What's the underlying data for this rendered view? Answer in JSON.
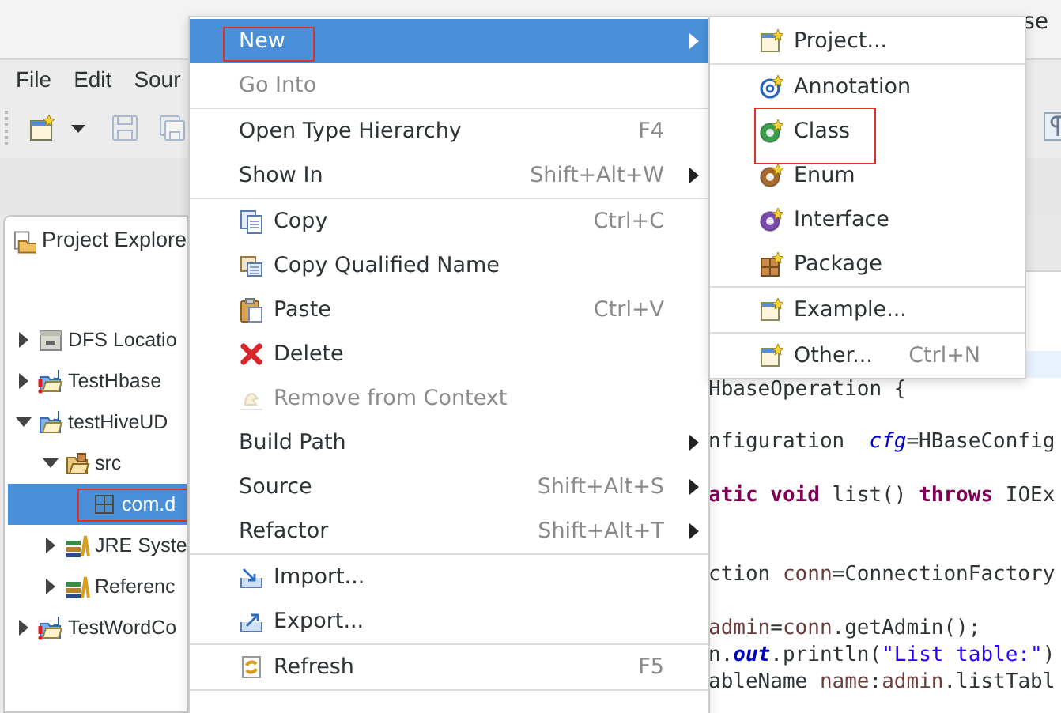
{
  "window": {
    "title": "se"
  },
  "menu_bar": [
    {
      "label": "File"
    },
    {
      "label": "Edit"
    },
    {
      "label": "Sour"
    }
  ],
  "toolbar": [
    {
      "kind": "new",
      "disabled": false
    },
    {
      "kind": "dropdown",
      "disabled": false
    },
    {
      "kind": "save",
      "disabled": true
    },
    {
      "kind": "save-all",
      "disabled": true
    },
    {
      "kind": "whitespace",
      "disabled": false
    }
  ],
  "project_explorer": {
    "title": "Project Explore",
    "items": [
      {
        "label": "DFS Locatio",
        "kind": "server",
        "expanded": false,
        "selected": false,
        "error": false,
        "framed": false
      },
      {
        "label": "TestHbase",
        "kind": "project",
        "expanded": false,
        "selected": false,
        "error": true,
        "framed": false
      },
      {
        "label": "testHiveUD",
        "kind": "project",
        "expanded": true,
        "selected": false,
        "error": false,
        "framed": false,
        "children": [
          {
            "label": "src",
            "kind": "source-folder",
            "expanded": true,
            "selected": false,
            "error": false,
            "framed": false,
            "children": [
              {
                "label": "com.d",
                "kind": "package",
                "selected": true,
                "error": false,
                "framed": true
              }
            ]
          },
          {
            "label": "JRE Syste",
            "kind": "library",
            "expanded": false,
            "selected": false,
            "error": false,
            "framed": false
          },
          {
            "label": "Referenc",
            "kind": "library",
            "expanded": false,
            "selected": false,
            "error": false,
            "framed": false
          }
        ]
      },
      {
        "label": "TestWordCo",
        "kind": "project",
        "expanded": false,
        "selected": false,
        "error": true,
        "framed": false
      }
    ]
  },
  "editor": {
    "lines": [
      {
        "kind": "blank",
        "current": true
      },
      {
        "kind": "code",
        "current": false,
        "tokens": [
          {
            "text": "HbaseOperation {",
            "kind": "plain"
          }
        ]
      },
      {
        "kind": "blank",
        "current": false
      },
      {
        "kind": "code",
        "current": false,
        "tokens": [
          {
            "text": "nfiguration  ",
            "kind": "plain"
          },
          {
            "text": "cfg",
            "kind": "field"
          },
          {
            "text": "=HBaseConfig",
            "kind": "plain"
          }
        ]
      },
      {
        "kind": "blank",
        "current": false
      },
      {
        "kind": "code",
        "current": false,
        "tokens": [
          {
            "text": "atic void",
            "kind": "keyword"
          },
          {
            "text": " list() ",
            "kind": "plain"
          },
          {
            "text": "throws",
            "kind": "keyword"
          },
          {
            "text": " IOEx",
            "kind": "plain"
          }
        ]
      },
      {
        "kind": "blank",
        "current": false
      },
      {
        "kind": "blank",
        "current": false
      },
      {
        "kind": "code",
        "current": false,
        "tokens": [
          {
            "text": "ction ",
            "kind": "plain"
          },
          {
            "text": "conn",
            "kind": "variable"
          },
          {
            "text": "=ConnectionFactory",
            "kind": "plain"
          }
        ]
      },
      {
        "kind": "blank",
        "current": false
      },
      {
        "kind": "code",
        "current": false,
        "tokens": [
          {
            "text": "admin",
            "kind": "variable"
          },
          {
            "text": "=",
            "kind": "plain"
          },
          {
            "text": "conn",
            "kind": "variable"
          },
          {
            "text": ".getAdmin();",
            "kind": "plain"
          }
        ]
      },
      {
        "kind": "code",
        "current": false,
        "tokens": [
          {
            "text": "n.",
            "kind": "plain"
          },
          {
            "text": "out",
            "kind": "static"
          },
          {
            "text": ".println(",
            "kind": "plain"
          },
          {
            "text": "\"List table:\"",
            "kind": "string"
          },
          {
            "text": ")",
            "kind": "plain"
          }
        ]
      },
      {
        "kind": "code",
        "current": false,
        "tokens": [
          {
            "text": "ableName ",
            "kind": "plain"
          },
          {
            "text": "name",
            "kind": "variable"
          },
          {
            "text": ":",
            "kind": "plain"
          },
          {
            "text": "admin",
            "kind": "variable"
          },
          {
            "text": ".listTabl",
            "kind": "plain"
          }
        ]
      }
    ]
  },
  "context_menu": {
    "items": [
      {
        "kind": "plain",
        "label": "New",
        "submenu": true,
        "disabled": false,
        "selected": true,
        "framed": true
      },
      {
        "kind": "plain",
        "label": "Go Into",
        "submenu": false,
        "disabled": true,
        "selected": false,
        "framed": false
      },
      {
        "kind": "separator"
      },
      {
        "kind": "plain",
        "label": "Open Type Hierarchy",
        "shortcut": "F4",
        "submenu": false,
        "disabled": false,
        "selected": false,
        "framed": false
      },
      {
        "kind": "plain",
        "label": "Show In",
        "shortcut": "Shift+Alt+W",
        "submenu": true,
        "disabled": false,
        "selected": false,
        "framed": false
      },
      {
        "kind": "separator"
      },
      {
        "kind": "copy",
        "label": "Copy",
        "shortcut": "Ctrl+C",
        "submenu": false,
        "disabled": false,
        "selected": false,
        "framed": false
      },
      {
        "kind": "copy-qualified",
        "label": "Copy Qualified Name",
        "submenu": false,
        "disabled": false,
        "selected": false,
        "framed": false
      },
      {
        "kind": "paste",
        "label": "Paste",
        "shortcut": "Ctrl+V",
        "submenu": false,
        "disabled": false,
        "selected": false,
        "framed": false
      },
      {
        "kind": "delete",
        "label": "Delete",
        "submenu": false,
        "disabled": false,
        "selected": false,
        "framed": false
      },
      {
        "kind": "remove",
        "label": "Remove from Context",
        "submenu": false,
        "disabled": true,
        "selected": false,
        "framed": false
      },
      {
        "kind": "plain",
        "label": "Build Path",
        "submenu": true,
        "disabled": false,
        "selected": false,
        "framed": false
      },
      {
        "kind": "plain",
        "label": "Source",
        "shortcut": "Shift+Alt+S",
        "submenu": true,
        "disabled": false,
        "selected": false,
        "framed": false
      },
      {
        "kind": "plain",
        "label": "Refactor",
        "shortcut": "Shift+Alt+T",
        "submenu": true,
        "disabled": false,
        "selected": false,
        "framed": false
      },
      {
        "kind": "separator"
      },
      {
        "kind": "import",
        "label": "Import...",
        "submenu": false,
        "disabled": false,
        "selected": false,
        "framed": false
      },
      {
        "kind": "export",
        "label": "Export...",
        "submenu": false,
        "disabled": false,
        "selected": false,
        "framed": false
      },
      {
        "kind": "separator"
      },
      {
        "kind": "refresh",
        "label": "Refresh",
        "shortcut": "F5",
        "submenu": false,
        "disabled": false,
        "selected": false,
        "framed": false
      },
      {
        "kind": "separator"
      }
    ]
  },
  "submenu": {
    "items": [
      {
        "kind": "wizard",
        "label": "Project...",
        "submenu": false,
        "disabled": false,
        "selected": false,
        "framed": false
      },
      {
        "kind": "separator"
      },
      {
        "kind": "annotation",
        "label": "Annotation",
        "submenu": false,
        "disabled": false,
        "selected": false,
        "framed": false
      },
      {
        "kind": "class",
        "label": "Class",
        "submenu": false,
        "disabled": false,
        "selected": false,
        "framed": true
      },
      {
        "kind": "enum",
        "label": "Enum",
        "submenu": false,
        "disabled": false,
        "selected": false,
        "framed": false
      },
      {
        "kind": "interface",
        "label": "Interface",
        "submenu": false,
        "disabled": false,
        "selected": false,
        "framed": false
      },
      {
        "kind": "new-package",
        "label": "Package",
        "submenu": false,
        "disabled": false,
        "selected": false,
        "framed": false
      },
      {
        "kind": "separator"
      },
      {
        "kind": "wizard",
        "label": "Example...",
        "submenu": false,
        "disabled": false,
        "selected": false,
        "framed": false
      },
      {
        "kind": "separator"
      },
      {
        "kind": "wizard",
        "label": "Other...",
        "shortcut": "Ctrl+N",
        "submenu": false,
        "disabled": false,
        "selected": false,
        "framed": false
      }
    ]
  }
}
